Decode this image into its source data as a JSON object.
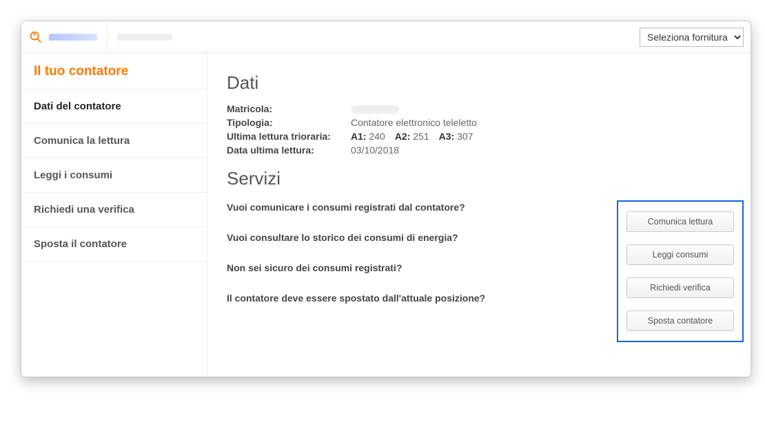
{
  "topbar": {
    "supply_select_label": "Seleziona fornitura"
  },
  "sidebar": {
    "title": "Il tuo contatore",
    "items": [
      {
        "label": "Dati del contatore",
        "active": true
      },
      {
        "label": "Comunica la lettura"
      },
      {
        "label": "Leggi i consumi"
      },
      {
        "label": "Richiedi una verifica"
      },
      {
        "label": "Sposta il contatore"
      }
    ]
  },
  "main": {
    "section_dati": "Dati",
    "labels": {
      "matricola": "Matricola:",
      "tipologia": "Tipologia:",
      "ultima_lettura": "Ultima lettura trioraria:",
      "data_ultima": "Data ultima lettura:"
    },
    "values": {
      "tipologia": "Contatore elettronico teleletto",
      "a1_label": "A1:",
      "a1": "240",
      "a2_label": "A2:",
      "a2": "251",
      "a3_label": "A3:",
      "a3": "307",
      "data_ultima": "03/10/2018"
    },
    "section_servizi": "Servizi",
    "services": [
      "Vuoi comunicare i consumi registrati dal contatore?",
      "Vuoi consultare lo storico dei consumi di energia?",
      "Non sei sicuro dei consumi registrati?",
      "Il contatore deve essere spostato dall'attuale posizione?"
    ],
    "actions": [
      "Comunica lettura",
      "Leggi consumi",
      "Richiedi verifica",
      "Sposta contatore"
    ]
  }
}
